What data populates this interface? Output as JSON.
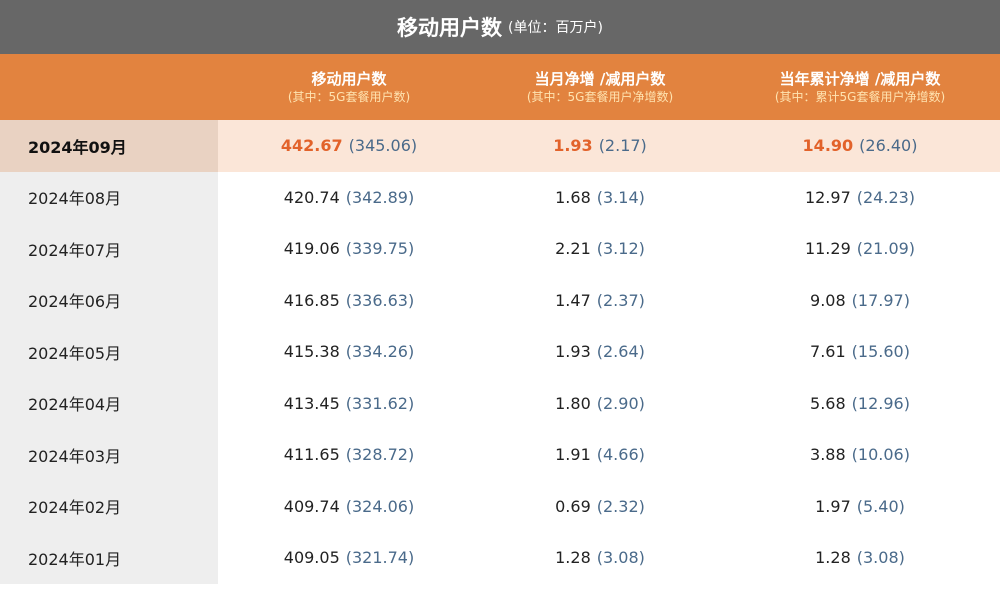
{
  "title": {
    "main": "移动用户数",
    "unit": "(单位：百万户)"
  },
  "headers": [
    {
      "main": "",
      "sub": ""
    },
    {
      "main": "移动用户数",
      "sub": "(其中：5G套餐用户数)"
    },
    {
      "main": "当月净增 /减用户数",
      "sub": "(其中：5G套餐用户净增数)"
    },
    {
      "main": "当年累计净增 /减用户数",
      "sub": "(其中：累计5G套餐用户净增数)"
    }
  ],
  "rows": [
    {
      "month": "2024年09月",
      "c1": "442.67",
      "c1s": "(345.06)",
      "c2": "1.93",
      "c2s": "(2.17)",
      "c3": "14.90",
      "c3s": "(26.40)"
    },
    {
      "month": "2024年08月",
      "c1": "420.74",
      "c1s": "(342.89)",
      "c2": "1.68",
      "c2s": "(3.14)",
      "c3": "12.97",
      "c3s": "(24.23)"
    },
    {
      "month": "2024年07月",
      "c1": "419.06",
      "c1s": "(339.75)",
      "c2": "2.21",
      "c2s": "(3.12)",
      "c3": "11.29",
      "c3s": "(21.09)"
    },
    {
      "month": "2024年06月",
      "c1": "416.85",
      "c1s": "(336.63)",
      "c2": "1.47",
      "c2s": "(2.37)",
      "c3": "9.08",
      "c3s": "(17.97)"
    },
    {
      "month": "2024年05月",
      "c1": "415.38",
      "c1s": "(334.26)",
      "c2": "1.93",
      "c2s": "(2.64)",
      "c3": "7.61",
      "c3s": "(15.60)"
    },
    {
      "month": "2024年04月",
      "c1": "413.45",
      "c1s": "(331.62)",
      "c2": "1.80",
      "c2s": "(2.90)",
      "c3": "5.68",
      "c3s": "(12.96)"
    },
    {
      "month": "2024年03月",
      "c1": "411.65",
      "c1s": "(328.72)",
      "c2": "1.91",
      "c2s": "(4.66)",
      "c3": "3.88",
      "c3s": "(10.06)"
    },
    {
      "month": "2024年02月",
      "c1": "409.74",
      "c1s": "(324.06)",
      "c2": "0.69",
      "c2s": "(2.32)",
      "c3": "1.97",
      "c3s": "(5.40)"
    },
    {
      "month": "2024年01月",
      "c1": "409.05",
      "c1s": "(321.74)",
      "c2": "1.28",
      "c2s": "(3.08)",
      "c3": "1.28",
      "c3s": "(3.08)"
    }
  ],
  "colors": {
    "title_bg": "#676767",
    "header_bg": "#e2833f",
    "highlight_value": "#e2622a",
    "sub_value": "#4a6a8a"
  }
}
